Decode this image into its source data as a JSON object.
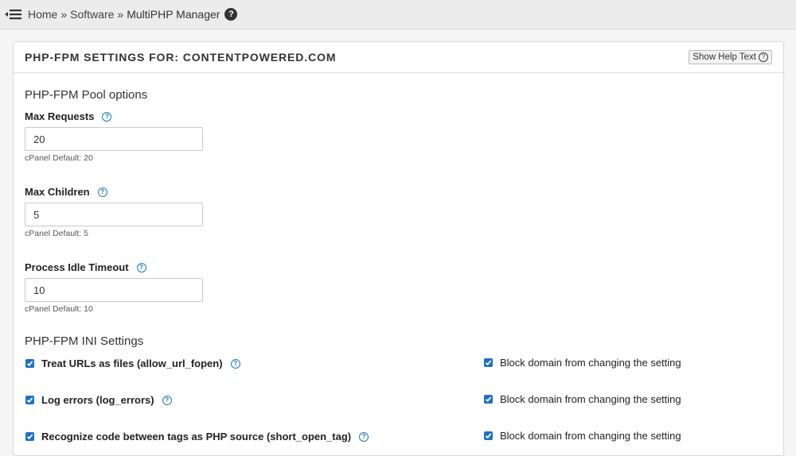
{
  "breadcrumb": {
    "items": [
      "Home",
      "Software"
    ],
    "separator": "»",
    "current": "MultiPHP Manager",
    "help_glyph": "?"
  },
  "panel": {
    "title": "PHP-FPM SETTINGS FOR: CONTENTPOWERED.COM",
    "show_help_label": "Show Help Text",
    "show_help_icon": "question-circle-icon"
  },
  "pool_options": {
    "heading": "PHP-FPM Pool options",
    "fields": [
      {
        "label": "Max Requests",
        "value": "20",
        "default_note": "cPanel Default: 20"
      },
      {
        "label": "Max Children",
        "value": "5",
        "default_note": "cPanel Default: 5"
      },
      {
        "label": "Process Idle Timeout",
        "value": "10",
        "default_note": "cPanel Default: 10"
      }
    ]
  },
  "ini_settings": {
    "heading": "PHP-FPM INI Settings",
    "rows": [
      {
        "label": "Treat URLs as files (allow_url_fopen)",
        "checked": true,
        "block_label": "Block domain from changing the setting",
        "block_checked": true
      },
      {
        "label": "Log errors (log_errors)",
        "checked": true,
        "block_label": "Block domain from changing the setting",
        "block_checked": true
      },
      {
        "label": "Recognize code between tags as PHP source (short_open_tag)",
        "checked": true,
        "block_label": "Block domain from changing the setting",
        "block_checked": true
      }
    ]
  },
  "colors": {
    "accent": "#1f6fc5",
    "help_icon": "#1f7ac2",
    "topbar_bg": "#ececec"
  }
}
